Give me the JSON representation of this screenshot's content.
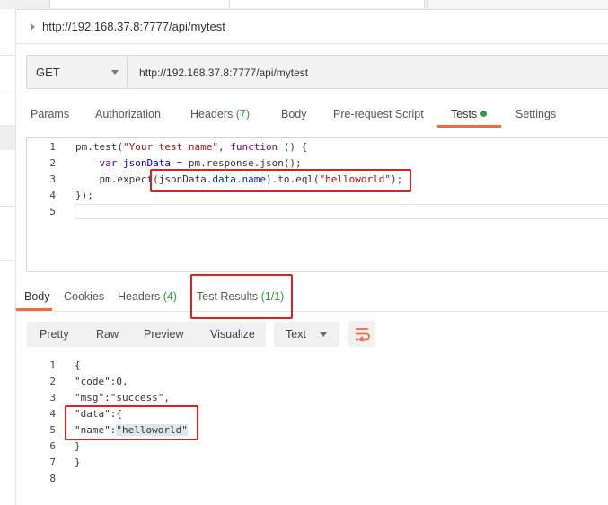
{
  "request": {
    "title": "http://192.168.37.8:7777/api/mytest",
    "method": "GET",
    "url": "http://192.168.37.8:7777/api/mytest"
  },
  "request_tabs": [
    {
      "label": "Params"
    },
    {
      "label": "Authorization"
    },
    {
      "label": "Headers",
      "count": "(7)"
    },
    {
      "label": "Body"
    },
    {
      "label": "Pre-request Script"
    },
    {
      "label": "Tests"
    },
    {
      "label": "Settings"
    }
  ],
  "editor": {
    "line_numbers": [
      "1",
      "2",
      "3",
      "4",
      "5"
    ],
    "line1": {
      "a": "pm.test(",
      "b": "\"Your test name\"",
      "c": ", ",
      "d": "function",
      "e": " () {"
    },
    "line2": {
      "a": "    ",
      "b": "var",
      "c": " ",
      "d": "jsonData",
      "e": " = pm.response.json();"
    },
    "line3": {
      "a": "    pm.expect(jsonData.",
      "b": "data",
      "c": ".",
      "d": "name",
      "e": ").to.eql(",
      "f": "\"helloworld\"",
      "g": ");"
    },
    "line4": "});"
  },
  "response_tabs": [
    {
      "label": "Body"
    },
    {
      "label": "Cookies"
    },
    {
      "label": "Headers",
      "count": "(4)"
    },
    {
      "label": "Test Results",
      "count": "(1/1)"
    }
  ],
  "view_buttons": [
    "Pretty",
    "Raw",
    "Preview",
    "Visualize"
  ],
  "format_select": "Text",
  "response": {
    "line_numbers": [
      "1",
      "2",
      "3",
      "4",
      "5",
      "6",
      "7",
      "8"
    ],
    "lines": [
      "{",
      "\"code\":0,",
      "\"msg\":\"success\",",
      "\"data\":{",
      "\"name\":\"helloworld\"",
      "}",
      "}",
      ""
    ],
    "line5_key": "\"name\":",
    "line5_value": "\"helloworld\""
  },
  "colors": {
    "accent": "#f26b3a",
    "success": "#2e9d3f",
    "annotation": "#e02020"
  }
}
